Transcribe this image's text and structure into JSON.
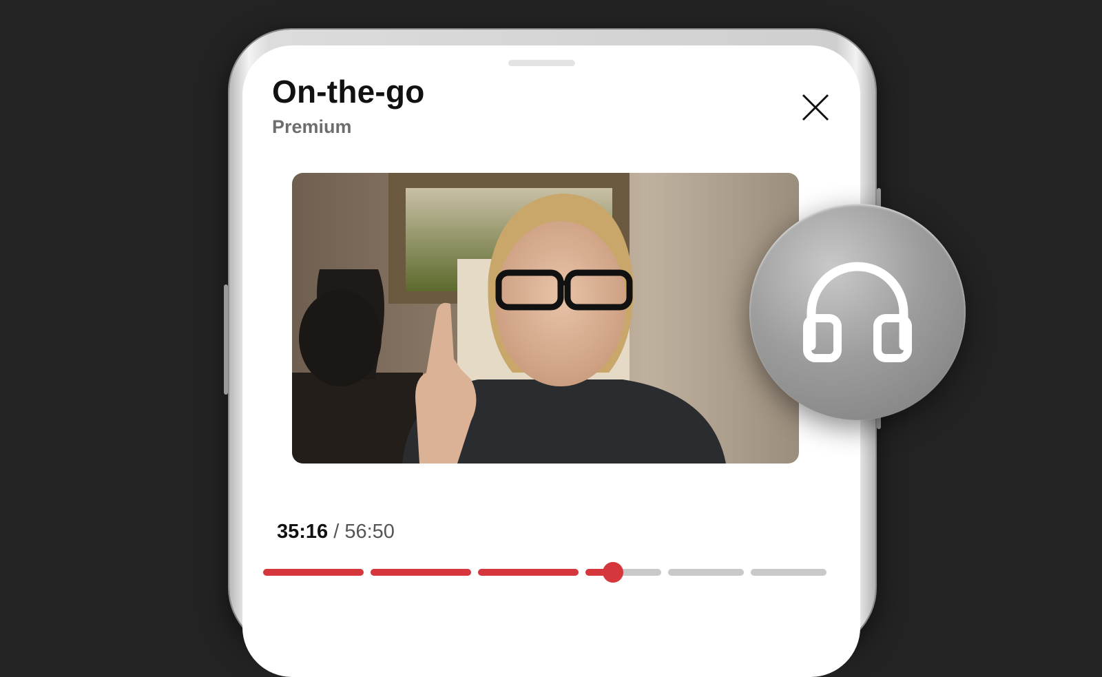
{
  "sheet": {
    "title": "On-the-go",
    "subtitle": "Premium"
  },
  "player": {
    "current_time": "35:16",
    "separator": " / ",
    "total_time": "56:50",
    "progress_fraction": 0.62
  },
  "progress_segments": [
    {
      "filled": 1.0
    },
    {
      "filled": 1.0
    },
    {
      "filled": 1.0
    },
    {
      "filled": 0.36
    },
    {
      "filled": 0.0
    },
    {
      "filled": 0.0
    }
  ],
  "icons": {
    "close": "close-icon",
    "audio": "headphones-icon"
  },
  "colors": {
    "accent": "#d6373d",
    "track": "#c9c9c9",
    "background": "#232323"
  }
}
